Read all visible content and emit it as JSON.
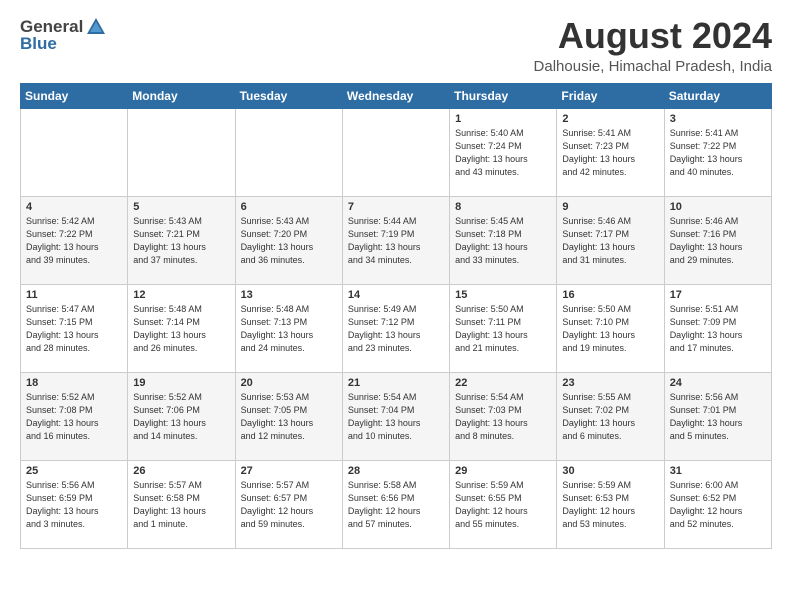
{
  "header": {
    "logo_general": "General",
    "logo_blue": "Blue",
    "month_year": "August 2024",
    "location": "Dalhousie, Himachal Pradesh, India"
  },
  "calendar": {
    "days_of_week": [
      "Sunday",
      "Monday",
      "Tuesday",
      "Wednesday",
      "Thursday",
      "Friday",
      "Saturday"
    ],
    "weeks": [
      [
        {
          "day": "",
          "content": ""
        },
        {
          "day": "",
          "content": ""
        },
        {
          "day": "",
          "content": ""
        },
        {
          "day": "",
          "content": ""
        },
        {
          "day": "1",
          "content": "Sunrise: 5:40 AM\nSunset: 7:24 PM\nDaylight: 13 hours\nand 43 minutes."
        },
        {
          "day": "2",
          "content": "Sunrise: 5:41 AM\nSunset: 7:23 PM\nDaylight: 13 hours\nand 42 minutes."
        },
        {
          "day": "3",
          "content": "Sunrise: 5:41 AM\nSunset: 7:22 PM\nDaylight: 13 hours\nand 40 minutes."
        }
      ],
      [
        {
          "day": "4",
          "content": "Sunrise: 5:42 AM\nSunset: 7:22 PM\nDaylight: 13 hours\nand 39 minutes."
        },
        {
          "day": "5",
          "content": "Sunrise: 5:43 AM\nSunset: 7:21 PM\nDaylight: 13 hours\nand 37 minutes."
        },
        {
          "day": "6",
          "content": "Sunrise: 5:43 AM\nSunset: 7:20 PM\nDaylight: 13 hours\nand 36 minutes."
        },
        {
          "day": "7",
          "content": "Sunrise: 5:44 AM\nSunset: 7:19 PM\nDaylight: 13 hours\nand 34 minutes."
        },
        {
          "day": "8",
          "content": "Sunrise: 5:45 AM\nSunset: 7:18 PM\nDaylight: 13 hours\nand 33 minutes."
        },
        {
          "day": "9",
          "content": "Sunrise: 5:46 AM\nSunset: 7:17 PM\nDaylight: 13 hours\nand 31 minutes."
        },
        {
          "day": "10",
          "content": "Sunrise: 5:46 AM\nSunset: 7:16 PM\nDaylight: 13 hours\nand 29 minutes."
        }
      ],
      [
        {
          "day": "11",
          "content": "Sunrise: 5:47 AM\nSunset: 7:15 PM\nDaylight: 13 hours\nand 28 minutes."
        },
        {
          "day": "12",
          "content": "Sunrise: 5:48 AM\nSunset: 7:14 PM\nDaylight: 13 hours\nand 26 minutes."
        },
        {
          "day": "13",
          "content": "Sunrise: 5:48 AM\nSunset: 7:13 PM\nDaylight: 13 hours\nand 24 minutes."
        },
        {
          "day": "14",
          "content": "Sunrise: 5:49 AM\nSunset: 7:12 PM\nDaylight: 13 hours\nand 23 minutes."
        },
        {
          "day": "15",
          "content": "Sunrise: 5:50 AM\nSunset: 7:11 PM\nDaylight: 13 hours\nand 21 minutes."
        },
        {
          "day": "16",
          "content": "Sunrise: 5:50 AM\nSunset: 7:10 PM\nDaylight: 13 hours\nand 19 minutes."
        },
        {
          "day": "17",
          "content": "Sunrise: 5:51 AM\nSunset: 7:09 PM\nDaylight: 13 hours\nand 17 minutes."
        }
      ],
      [
        {
          "day": "18",
          "content": "Sunrise: 5:52 AM\nSunset: 7:08 PM\nDaylight: 13 hours\nand 16 minutes."
        },
        {
          "day": "19",
          "content": "Sunrise: 5:52 AM\nSunset: 7:06 PM\nDaylight: 13 hours\nand 14 minutes."
        },
        {
          "day": "20",
          "content": "Sunrise: 5:53 AM\nSunset: 7:05 PM\nDaylight: 13 hours\nand 12 minutes."
        },
        {
          "day": "21",
          "content": "Sunrise: 5:54 AM\nSunset: 7:04 PM\nDaylight: 13 hours\nand 10 minutes."
        },
        {
          "day": "22",
          "content": "Sunrise: 5:54 AM\nSunset: 7:03 PM\nDaylight: 13 hours\nand 8 minutes."
        },
        {
          "day": "23",
          "content": "Sunrise: 5:55 AM\nSunset: 7:02 PM\nDaylight: 13 hours\nand 6 minutes."
        },
        {
          "day": "24",
          "content": "Sunrise: 5:56 AM\nSunset: 7:01 PM\nDaylight: 13 hours\nand 5 minutes."
        }
      ],
      [
        {
          "day": "25",
          "content": "Sunrise: 5:56 AM\nSunset: 6:59 PM\nDaylight: 13 hours\nand 3 minutes."
        },
        {
          "day": "26",
          "content": "Sunrise: 5:57 AM\nSunset: 6:58 PM\nDaylight: 13 hours\nand 1 minute."
        },
        {
          "day": "27",
          "content": "Sunrise: 5:57 AM\nSunset: 6:57 PM\nDaylight: 12 hours\nand 59 minutes."
        },
        {
          "day": "28",
          "content": "Sunrise: 5:58 AM\nSunset: 6:56 PM\nDaylight: 12 hours\nand 57 minutes."
        },
        {
          "day": "29",
          "content": "Sunrise: 5:59 AM\nSunset: 6:55 PM\nDaylight: 12 hours\nand 55 minutes."
        },
        {
          "day": "30",
          "content": "Sunrise: 5:59 AM\nSunset: 6:53 PM\nDaylight: 12 hours\nand 53 minutes."
        },
        {
          "day": "31",
          "content": "Sunrise: 6:00 AM\nSunset: 6:52 PM\nDaylight: 12 hours\nand 52 minutes."
        }
      ]
    ]
  }
}
